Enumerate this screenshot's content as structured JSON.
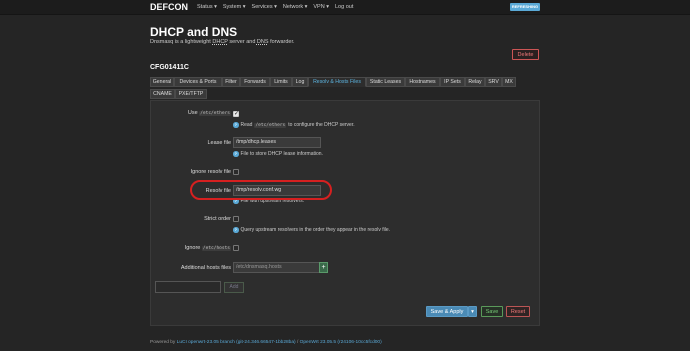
{
  "header": {
    "brand": "DEFCON",
    "nav": [
      "Status ▾",
      "System ▾",
      "Services ▾",
      "Network ▾",
      "VPN ▾",
      "Log out"
    ],
    "refresh_label": "REFRESHING"
  },
  "page": {
    "title": "DHCP and DNS",
    "subtitle_prefix": "Dnsmasq is a lightweight ",
    "subtitle_dhcp": "DHCP",
    "subtitle_mid": " server and ",
    "subtitle_dns": "DNS",
    "subtitle_suffix": " forwarder.",
    "delete_label": "Delete",
    "section_title": "CFG01411C"
  },
  "tabs": {
    "row1": [
      "General",
      "Devices & Ports",
      "Filter",
      "Forwards",
      "Limits",
      "Log",
      "Resolv & Hosts Files",
      "Static Leases",
      "Hostnames",
      "IP Sets",
      "Relay",
      "SRV",
      "MX"
    ],
    "row2": [
      "CNAME",
      "PXE/TFTP"
    ],
    "active": "Resolv & Hosts Files"
  },
  "form": {
    "use_ethers": {
      "label_prefix": "Use",
      "label_code": "/etc/ethers",
      "checked": true,
      "hint_prefix": "Read",
      "hint_code": "/etc/ethers",
      "hint_suffix": "to configure the DHCP server."
    },
    "lease_file": {
      "label": "Lease file",
      "value": "/tmp/dhcp.leases",
      "hint": "File to store DHCP lease information."
    },
    "ignore_resolv": {
      "label": "Ignore resolv file",
      "checked": false
    },
    "resolv_file": {
      "label": "Resolv file",
      "value": "/tmp/resolv.conf.wg",
      "hint": "File with upstream resolvers."
    },
    "strict_order": {
      "label": "Strict order",
      "checked": false,
      "hint": "Query upstream resolvers in the order they appear in the resolv file."
    },
    "ignore_hosts": {
      "label_prefix": "Ignore",
      "label_code": "/etc/hosts",
      "checked": false
    },
    "additional_hosts": {
      "label": "Additional hosts files",
      "placeholder": "/etc/dnsmasq.hosts",
      "plus": "+"
    },
    "add_label": "Add"
  },
  "actions": {
    "apply_label": "Save & Apply",
    "apply_arrow": "▾",
    "save_label": "Save",
    "reset_label": "Reset"
  },
  "footer": {
    "prefix": "Powered by ",
    "luci_link": "LuCI openwrt-23.05 branch (git-24.346.66547-1bb28ba)",
    "sep": " / ",
    "openwrt_link": "OpenWrt 23.05.5 (r24106-10cc5fcd00)"
  }
}
